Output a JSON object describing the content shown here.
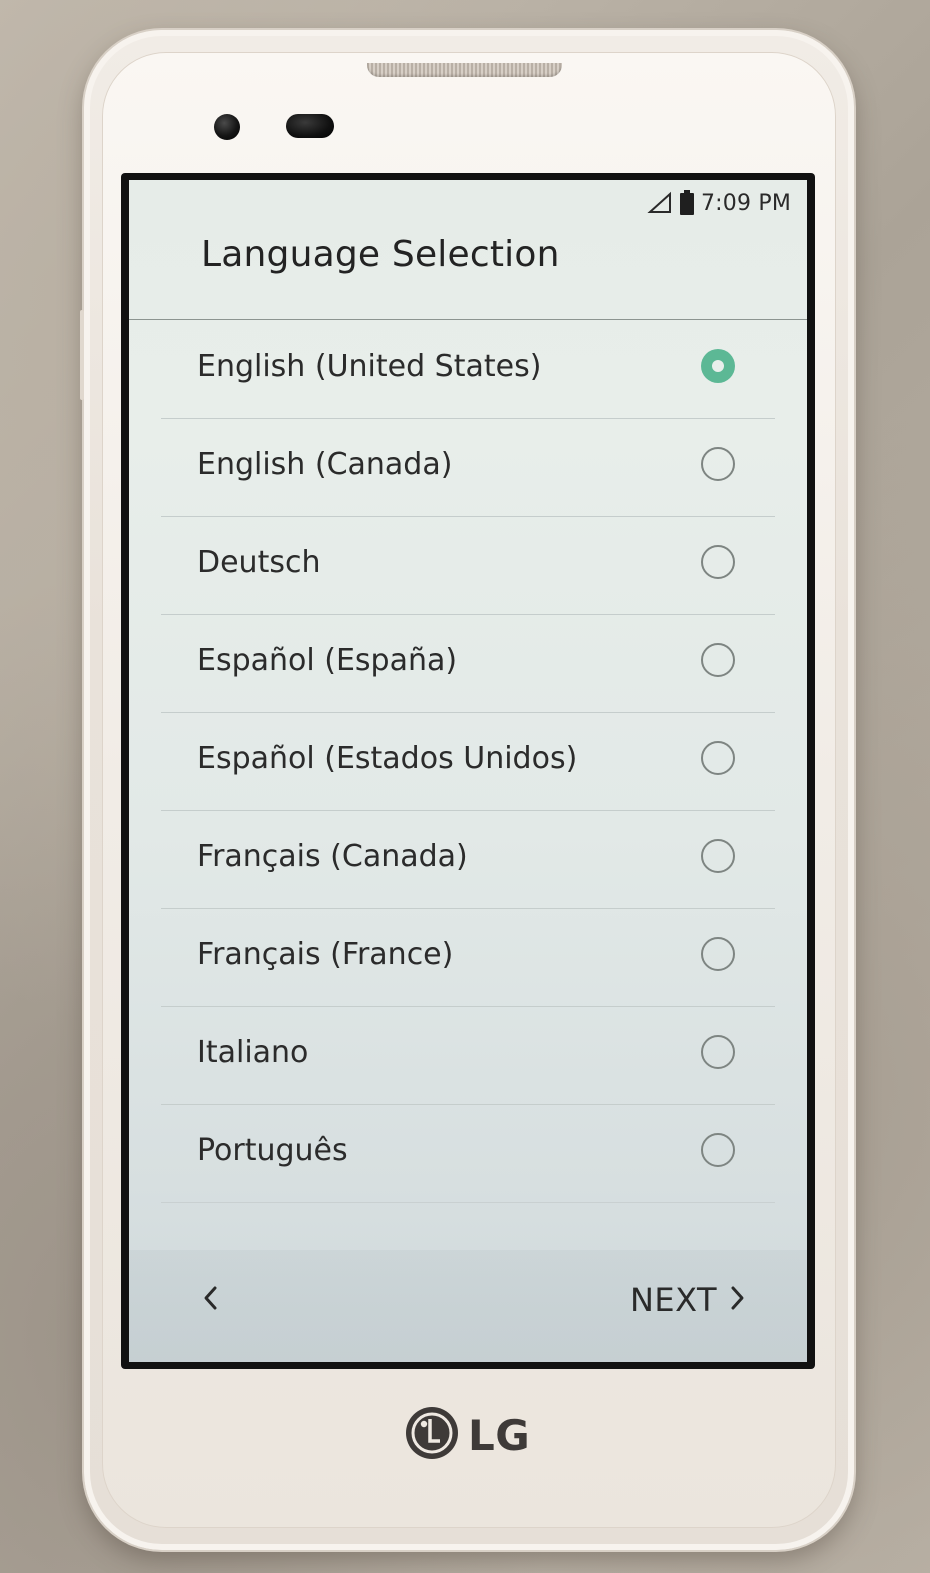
{
  "status_bar": {
    "time": "7:09 PM",
    "signal_icon": "cell-signal-icon",
    "battery_icon": "battery-icon"
  },
  "header": {
    "title": "Language Selection"
  },
  "languages": [
    {
      "label": "English (United States)",
      "selected": true
    },
    {
      "label": "English (Canada)",
      "selected": false
    },
    {
      "label": "Deutsch",
      "selected": false
    },
    {
      "label": "Español (España)",
      "selected": false
    },
    {
      "label": "Español (Estados Unidos)",
      "selected": false
    },
    {
      "label": "Français (Canada)",
      "selected": false
    },
    {
      "label": "Français (France)",
      "selected": false
    },
    {
      "label": "Italiano",
      "selected": false
    },
    {
      "label": "Português",
      "selected": false
    }
  ],
  "nav": {
    "back_icon": "chevron-left-icon",
    "next_label": "NEXT",
    "next_icon": "chevron-right-icon"
  },
  "brand": {
    "name": "LG",
    "logo_icon": "lg-logo-icon"
  },
  "colors": {
    "accent": "#5cb895",
    "text": "#2b2b2b"
  }
}
